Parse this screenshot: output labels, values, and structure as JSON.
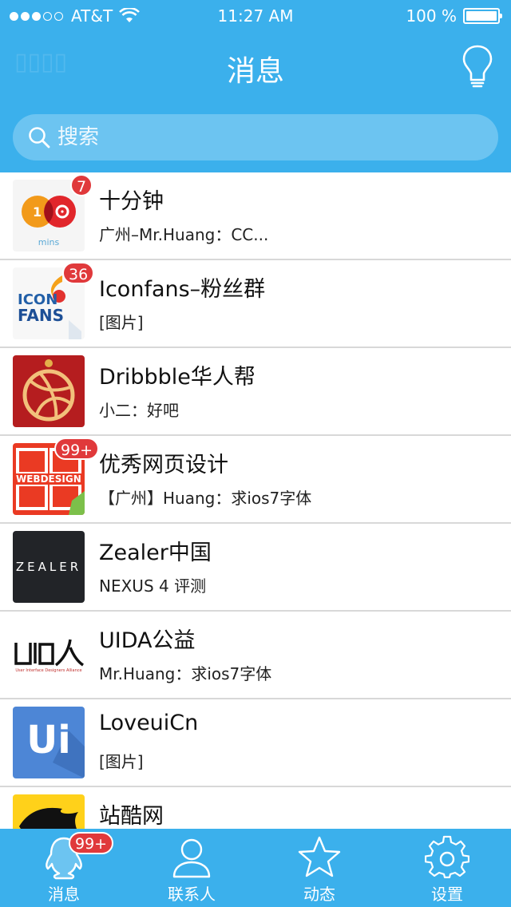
{
  "status_bar": {
    "carrier": "AT&T",
    "time": "11:27 AM",
    "battery_label": "100 %",
    "battery_level": 1.0,
    "signal_bars": 3
  },
  "nav": {
    "title": "消息",
    "tip_icon": "lightbulb-icon"
  },
  "search": {
    "placeholder": "搜索",
    "icon": "search-icon"
  },
  "conversations": [
    {
      "title": "十分钟",
      "preview": "广州–Mr.Huang：CC...",
      "badge": "7",
      "avatar": "ten-minutes-logo"
    },
    {
      "title": "Iconfans–粉丝群",
      "preview": "[图片]",
      "badge": "36",
      "avatar": "iconfans-logo"
    },
    {
      "title": "Dribbble华人帮",
      "preview": "小二：好吧",
      "badge": "",
      "avatar": "dribbble-logo"
    },
    {
      "title": "优秀网页设计",
      "preview": "【广州】Huang：求ios7字体",
      "badge": "99+",
      "avatar": "webdesign-logo"
    },
    {
      "title": "Zealer中国",
      "preview": "NEXUS 4 评测",
      "badge": "",
      "avatar": "zealer-logo"
    },
    {
      "title": "UIDA公益",
      "preview": "Mr.Huang：求ios7字体",
      "badge": "",
      "avatar": "uida-logo"
    },
    {
      "title": "LoveuiCn",
      "preview": "[图片]",
      "badge": "",
      "avatar": "loveui-logo"
    },
    {
      "title": "站酷网",
      "preview": "",
      "badge": "",
      "avatar": "zcool-logo"
    }
  ],
  "avatar_text": {
    "zealer": "ZEALER",
    "uida_sub": "User Interface Designers Alliance",
    "loveui": "Ui",
    "tenmin_sub": "mins",
    "iconfans": "FANS",
    "webdesign": "WEBDESIGN"
  },
  "tabbar": {
    "tabs": [
      {
        "label": "消息",
        "icon": "penguin-icon",
        "badge": "99+",
        "active": true
      },
      {
        "label": "联系人",
        "icon": "person-icon",
        "badge": ""
      },
      {
        "label": "动态",
        "icon": "star-icon",
        "badge": ""
      },
      {
        "label": "设置",
        "icon": "gear-icon",
        "badge": ""
      }
    ]
  },
  "colors": {
    "brand": "#3bb0ec",
    "badge": "#e0393b"
  }
}
